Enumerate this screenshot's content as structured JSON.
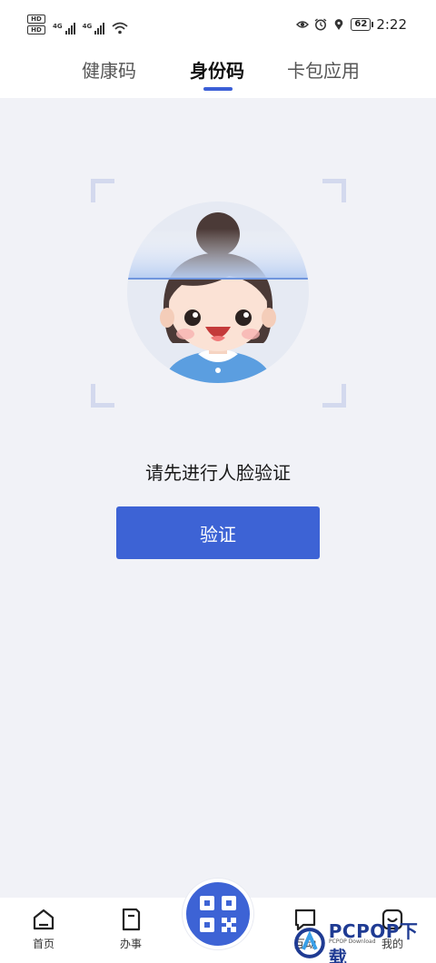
{
  "status_bar": {
    "hd_badges": [
      "HD",
      "HD"
    ],
    "signal_gen_1": "4G",
    "signal_gen_2": "4G",
    "battery": "62",
    "time": "2:22"
  },
  "tabs": [
    {
      "label": "健康码",
      "active": false
    },
    {
      "label": "身份码",
      "active": true
    },
    {
      "label": "卡包应用",
      "active": false
    }
  ],
  "main": {
    "prompt": "请先进行人脸验证",
    "verify_button": "验证"
  },
  "bottom_nav": {
    "items": [
      {
        "label": "首页",
        "icon": "home-icon"
      },
      {
        "label": "办事",
        "icon": "document-icon"
      },
      {
        "label": "",
        "icon": "qr-code-icon"
      },
      {
        "label": "互动",
        "icon": "chat-icon"
      },
      {
        "label": "我的",
        "icon": "profile-icon"
      }
    ]
  },
  "watermark": {
    "brand": "PCPOP下载",
    "sub": "PCPOP Download"
  },
  "colors": {
    "accent": "#3d63d5",
    "background": "#f1f2f7",
    "frame_corner": "#d3d9ee"
  }
}
